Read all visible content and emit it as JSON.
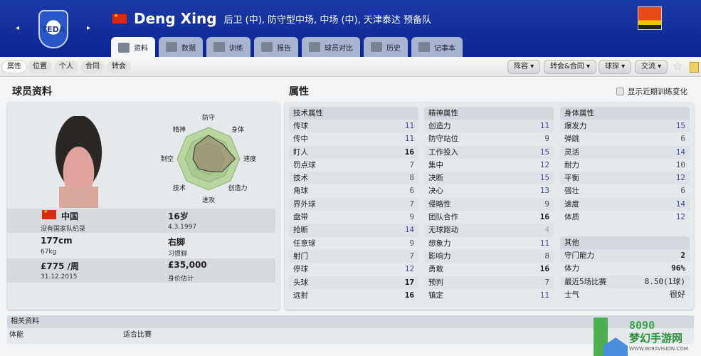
{
  "header": {
    "club_crest_text": "TEDA",
    "flag": "china-flag",
    "player_name": "Deng Xing",
    "description": "后卫 (中), 防守型中场, 中场 (中), 天津泰达 预备队"
  },
  "tabs": [
    {
      "label": "资料",
      "icon": "profile-icon",
      "active": true
    },
    {
      "label": "数据",
      "icon": "bar-chart-icon"
    },
    {
      "label": "训练",
      "icon": "ball-icon"
    },
    {
      "label": "报告",
      "icon": "report-icon"
    },
    {
      "label": "球员对比",
      "icon": "compare-icon"
    },
    {
      "label": "历史",
      "icon": "history-icon"
    },
    {
      "label": "记事本",
      "icon": "notebook-icon"
    }
  ],
  "subnav": [
    "属性",
    "位置",
    "个人",
    "合同",
    "转会"
  ],
  "menus": [
    "阵容",
    "转会&合同",
    "球探",
    "交流"
  ],
  "left": {
    "title": "球员资料",
    "nationality": "中国",
    "intl": "没有国家队纪录",
    "age": "16岁",
    "dob": "4.3.1997",
    "height": "177cm",
    "weight": "67kg",
    "foot": "右脚",
    "foot_label": "习惯脚",
    "wage": "£775 /周",
    "contract": "31.12.2015",
    "value": "£35,000",
    "value_label": "身价估计"
  },
  "radar": {
    "axes": [
      "防守",
      "身体",
      "速度",
      "创造力",
      "进攻",
      "技术",
      "制空",
      "精神"
    ],
    "values": [
      0.75,
      0.65,
      0.85,
      0.6,
      0.4,
      0.45,
      0.5,
      0.6
    ]
  },
  "attributes_title": "属性",
  "show_training": "显示近期训练变化",
  "technical": {
    "title": "技术属性",
    "rows": [
      [
        "传球",
        11
      ],
      [
        "传中",
        11
      ],
      [
        "盯人",
        16
      ],
      [
        "罚点球",
        7
      ],
      [
        "技术",
        8
      ],
      [
        "角球",
        6
      ],
      [
        "界外球",
        7
      ],
      [
        "盘带",
        9
      ],
      [
        "抢断",
        14
      ],
      [
        "任意球",
        9
      ],
      [
        "射门",
        7
      ],
      [
        "停球",
        12
      ],
      [
        "头球",
        17
      ],
      [
        "远射",
        16
      ]
    ]
  },
  "mental": {
    "title": "精神属性",
    "rows": [
      [
        "创造力",
        11
      ],
      [
        "防守站位",
        9
      ],
      [
        "工作投入",
        15
      ],
      [
        "集中",
        12
      ],
      [
        "决断",
        15
      ],
      [
        "决心",
        13
      ],
      [
        "侵略性",
        9
      ],
      [
        "团队合作",
        16
      ],
      [
        "无球跑动",
        4
      ],
      [
        "想象力",
        11
      ],
      [
        "影响力",
        8
      ],
      [
        "勇敢",
        16
      ],
      [
        "预判",
        7
      ],
      [
        "镇定",
        11
      ]
    ]
  },
  "physical": {
    "title": "身体属性",
    "rows": [
      [
        "爆发力",
        15
      ],
      [
        "弹跳",
        6
      ],
      [
        "灵活",
        14
      ],
      [
        "耐力",
        10
      ],
      [
        "平衡",
        12
      ],
      [
        "强壮",
        6
      ],
      [
        "速度",
        14
      ],
      [
        "体质",
        12
      ]
    ]
  },
  "other": {
    "title": "其他",
    "rows": [
      [
        "守门能力",
        "2"
      ],
      [
        "体力",
        "96%"
      ],
      [
        "最近5场比赛",
        "8.50(1球)"
      ],
      [
        "士气",
        "很好"
      ]
    ]
  },
  "related": {
    "title": "相关资料",
    "label": "体能",
    "value": "适合比赛"
  },
  "watermark": {
    "line1": "8090",
    "line2": "梦幻手游网",
    "line3": "WWW.8090VISION.COM"
  }
}
